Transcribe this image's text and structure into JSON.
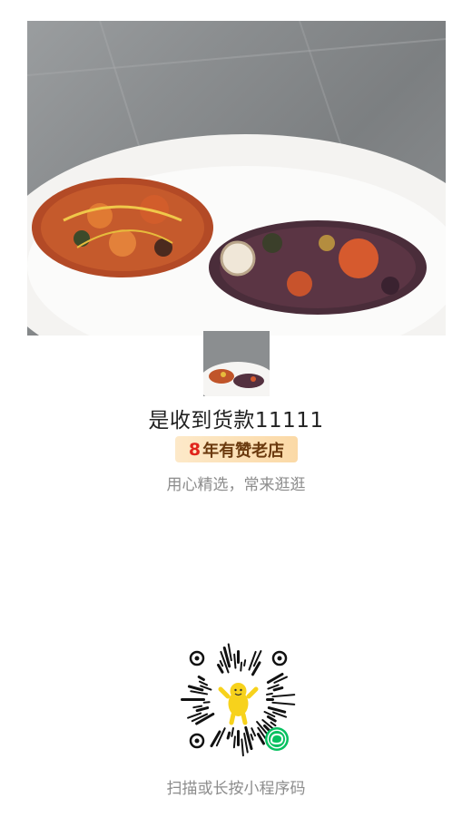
{
  "store": {
    "name": "是收到货款11111",
    "badge_years": "8",
    "badge_text": "年有赞老店",
    "slogan": "用心精选，常来逛逛"
  },
  "qr": {
    "caption": "扫描或长按小程序码"
  },
  "colors": {
    "badge_year": "#e0241b",
    "badge_text": "#6b3a0e",
    "badge_bg": "#fbd9a6",
    "muted_text": "#8c8c8c",
    "wechat_green": "#07c160"
  },
  "images": {
    "hero": "dried-fruit-slices-on-plate-photo",
    "thumb": "dried-fruit-slices-thumbnail",
    "qr_icon": "wechat-mini-program-icon"
  }
}
